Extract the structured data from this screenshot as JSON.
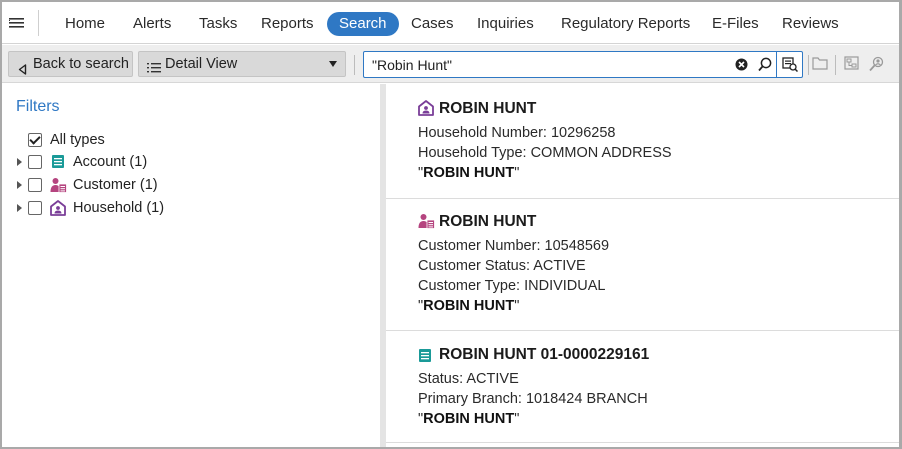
{
  "nav": {
    "items": [
      {
        "label": "Home"
      },
      {
        "label": "Alerts"
      },
      {
        "label": "Tasks"
      },
      {
        "label": "Reports"
      },
      {
        "label": "Search"
      },
      {
        "label": "Cases"
      },
      {
        "label": "Inquiries"
      },
      {
        "label": "Regulatory Reports"
      },
      {
        "label": "E-Files"
      },
      {
        "label": "Reviews"
      }
    ],
    "active": "Search"
  },
  "toolbar": {
    "back_label": "Back to search",
    "view_selected": "Detail View",
    "search_value": "\"Robin Hunt\""
  },
  "filters": {
    "title": "Filters",
    "all_types_label": "All types",
    "all_types_checked": true,
    "types": [
      {
        "label": "Account (1)",
        "icon": "account-icon",
        "checked": false
      },
      {
        "label": "Customer (1)",
        "icon": "customer-icon",
        "checked": false
      },
      {
        "label": "Household (1)",
        "icon": "household-icon",
        "checked": false
      }
    ]
  },
  "results": [
    {
      "icon": "household-icon",
      "title": "ROBIN HUNT",
      "lines": [
        "Household Number: 10296258",
        "Household Type: COMMON ADDRESS"
      ],
      "match": "ROBIN HUNT"
    },
    {
      "icon": "customer-icon",
      "title": "ROBIN HUNT",
      "lines": [
        "Customer Number: 10548569",
        "Customer Status: ACTIVE",
        "Customer Type: INDIVIDUAL"
      ],
      "match": "ROBIN HUNT"
    },
    {
      "icon": "account-icon",
      "title": "ROBIN HUNT 01-0000229161",
      "lines": [
        "Status: ACTIVE",
        "Primary Branch: 1018424 BRANCH"
      ],
      "match": "ROBIN HUNT"
    }
  ],
  "colors": {
    "accent": "#2f78c4",
    "account": "#1a9a98",
    "customer": "#b5447f",
    "household": "#7a3e98"
  }
}
